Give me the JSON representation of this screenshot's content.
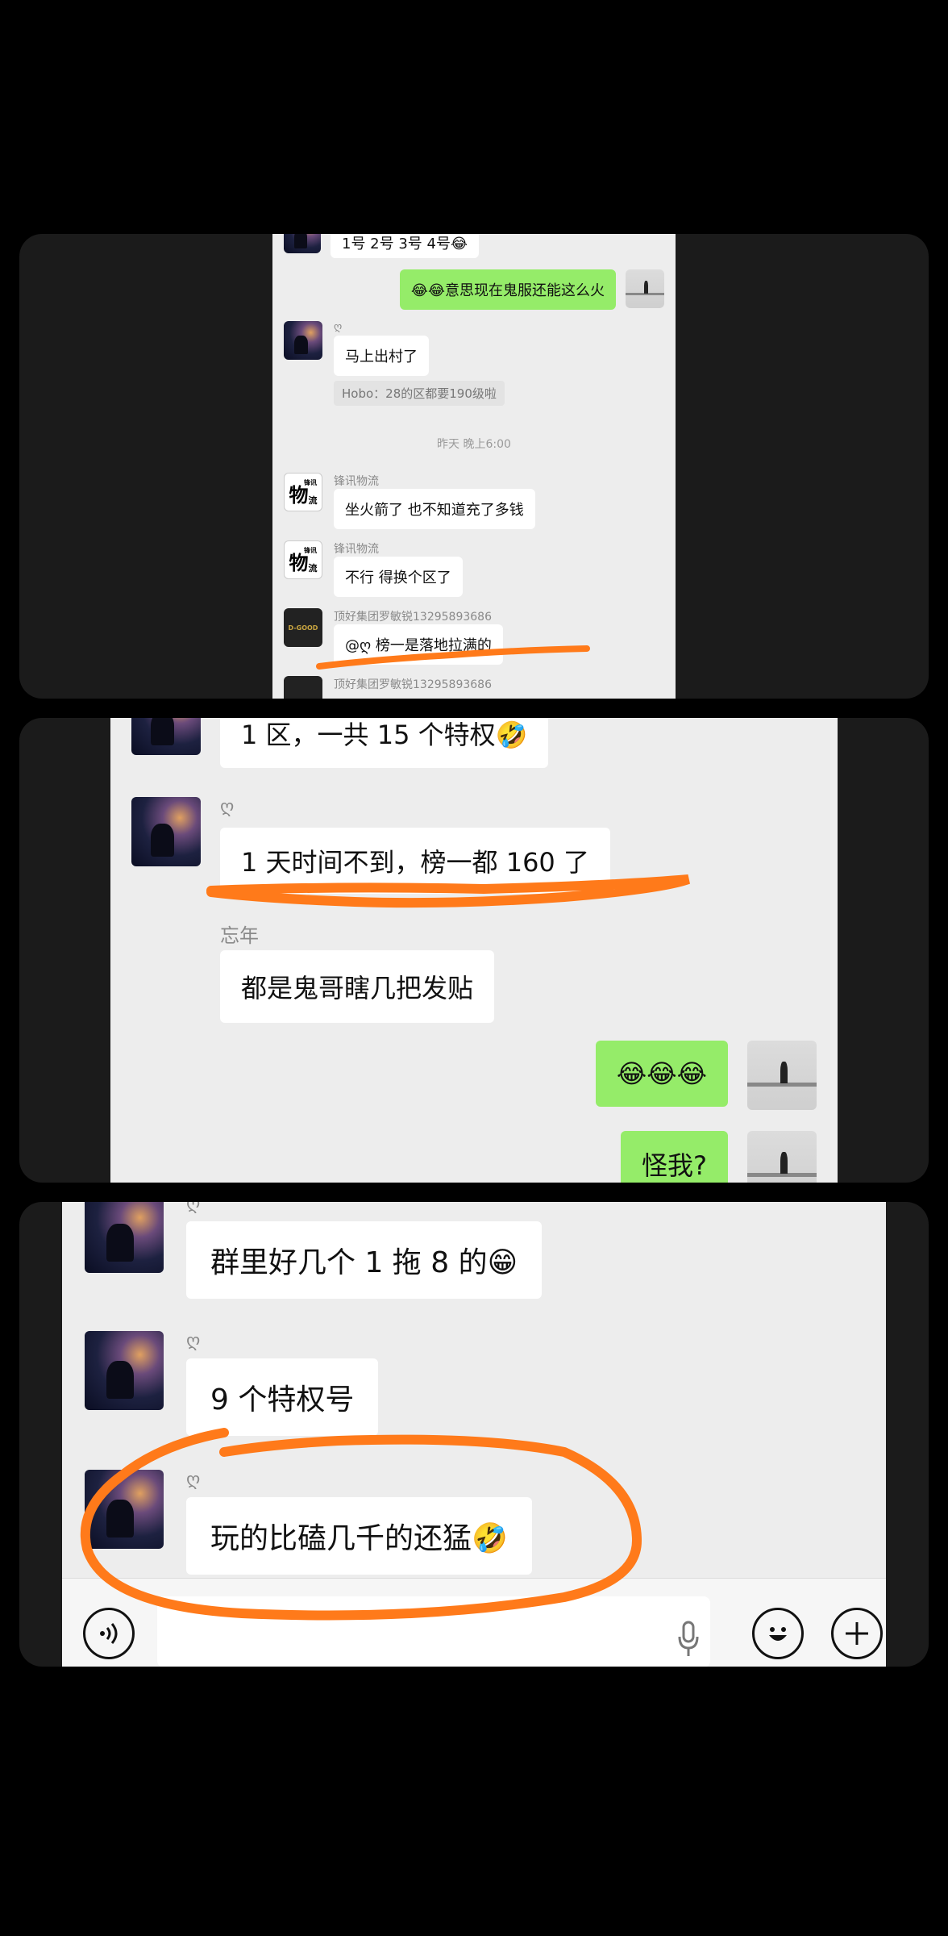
{
  "panel1": {
    "top_partial": "1号 2号 3号 4号😂",
    "my_msg": "😂😂意思现在鬼服还能这么火",
    "sender_symbol": "ღ",
    "msg_leave": "马上出村了",
    "quote_hobo": "Hobo：28的区都要190级啦",
    "timestamp": "昨天 晚上6:00",
    "sender_fengxun": "锋讯物流",
    "fengxun_avatar_top": "锋讯",
    "fengxun_avatar_main": "物",
    "fengxun_avatar_sub": "流",
    "msg_rocket": "坐火箭了 也不知道充了多钱",
    "msg_switch": "不行 得换个区了",
    "sender_dinghao": "顶好集团罗敏锐13295893686",
    "dgood_logo": "D-GOOD",
    "msg_rank": "@ღ 榜一是落地拉满的"
  },
  "panel2": {
    "top_partial": "1 区，一共 15 个特权🤣",
    "sender_symbol": "ღ",
    "msg_day": "1 天时间不到，榜一都 160 了",
    "sender_wangnian": "忘年",
    "msg_ghost": "都是鬼哥瞎几把发贴",
    "my_emoji": "😂😂😂",
    "my_blame": "怪我?"
  },
  "panel3": {
    "sender_symbol": "ღ",
    "msg_group": "群里好几个 1 拖 8 的😁",
    "msg_nine": "9 个特权号",
    "msg_play": "玩的比磕几千的还猛🤣"
  },
  "toolbar": {
    "voice_icon": "voice-icon",
    "mic_icon": "mic-icon",
    "emoji_icon": "emoji-icon",
    "add_icon": "plus-icon"
  },
  "colors": {
    "highlight": "#ff7a1a",
    "my_bubble": "#95ec69",
    "chat_bg": "#ededed"
  }
}
